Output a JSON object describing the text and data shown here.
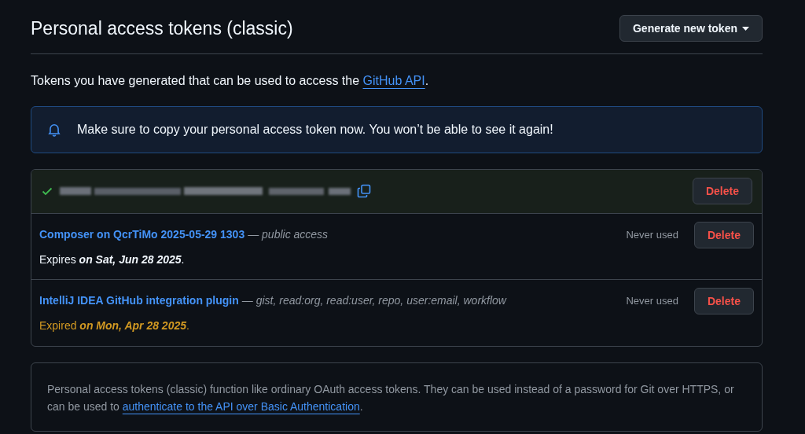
{
  "header": {
    "title": "Personal access tokens (classic)",
    "generate_button": "Generate new token"
  },
  "intro": {
    "text": "Tokens you have generated that can be used to access the",
    "link": "GitHub API",
    "end": "."
  },
  "alert": {
    "text": "Make sure to copy your personal access token now. You won’t be able to see it again!"
  },
  "tokens": [
    {
      "kind": "new",
      "delete": "Delete"
    },
    {
      "kind": "existing",
      "name": "Composer on QcrTiMo 2025-05-29 1303",
      "scopes": "— public access",
      "usage": "Never used",
      "expiry": "Expires **on Sat, Jun 28 2025**.",
      "expired": false,
      "delete": "Delete"
    },
    {
      "kind": "existing",
      "name": "IntelliJ IDEA GitHub integration plugin",
      "scopes": "— gist, read:org, read:user, repo, user:email, workflow",
      "usage": "Never used",
      "expiry": "Expired **on Mon, Apr 28 2025**.",
      "expired": true,
      "delete": "Delete"
    }
  ],
  "footer": {
    "text": "Personal access tokens (classic) function like ordinary OAuth access tokens. They can be used instead of a password for Git over HTTPS, or can be used to",
    "link": "authenticate to the API over Basic Authentication",
    "end": "."
  }
}
